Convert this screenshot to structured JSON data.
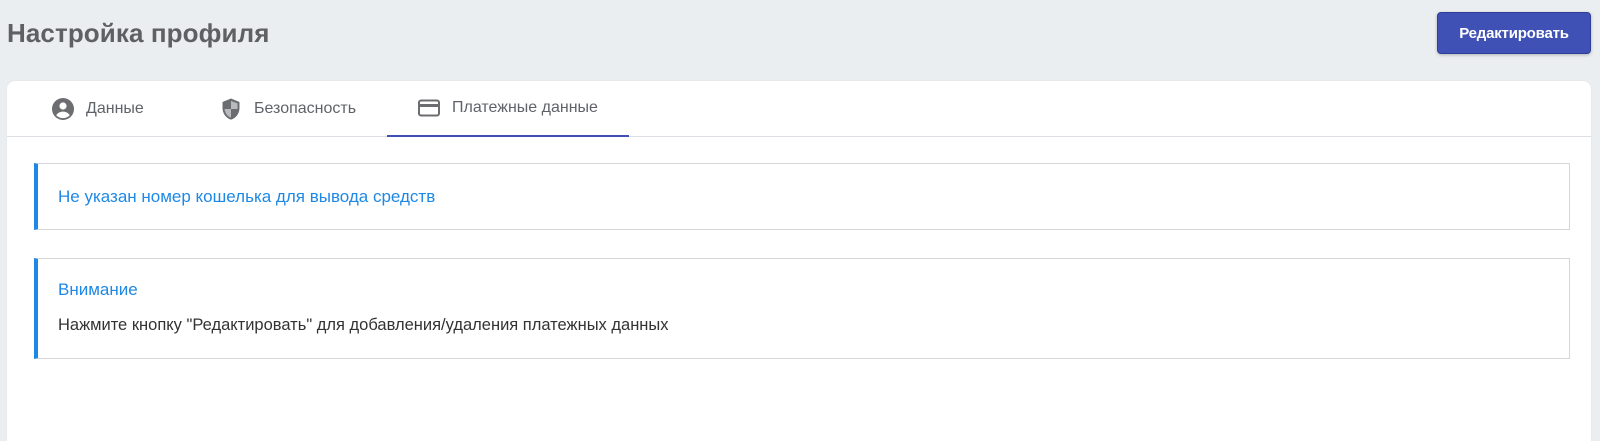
{
  "header": {
    "title": "Настройка профиля",
    "edit_button_label": "Редактировать"
  },
  "tabs": [
    {
      "label": "Данные",
      "icon": "account-circle-icon"
    },
    {
      "label": "Безопасность",
      "icon": "shield-icon"
    },
    {
      "label": "Платежные данные",
      "icon": "credit-card-icon",
      "active": true
    }
  ],
  "alerts": {
    "wallet_missing": "Не указан номер кошелька для вывода средств",
    "attention_title": "Внимание",
    "attention_text": "Нажмите кнопку \"Редактировать\" для добавления/удаления платежных данных"
  },
  "colors": {
    "accent": "#3f51b5",
    "info": "#1e88e5",
    "background": "#ebeef1"
  }
}
